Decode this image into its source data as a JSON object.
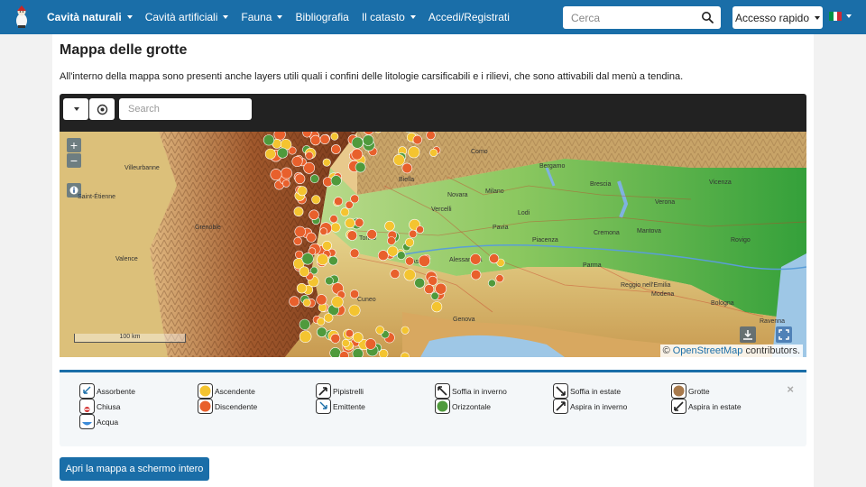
{
  "navbar": {
    "items": [
      {
        "label": "Cavità naturali",
        "dropdown": true,
        "active": true
      },
      {
        "label": "Cavità artificiali",
        "dropdown": true,
        "active": false
      },
      {
        "label": "Fauna",
        "dropdown": true,
        "active": false
      },
      {
        "label": "Bibliografia",
        "dropdown": false,
        "active": false
      },
      {
        "label": "Il catasto",
        "dropdown": true,
        "active": false
      },
      {
        "label": "Accedi/Registrati",
        "dropdown": false,
        "active": false
      }
    ],
    "search_placeholder": "Cerca",
    "search_icon": "search-icon",
    "quick_access_label": "Accesso rapido",
    "language_flag_colors": [
      "#009246",
      "#ffffff",
      "#ce2b37"
    ],
    "brand_color": "#1a6ea8"
  },
  "page": {
    "title": "Mappa delle grotte",
    "intro": "All'interno della mappa sono presenti anche layers utili quali i confini delle litologie carsificabili e i rilievi, che sono attivabili dal menù a tendina."
  },
  "map_toolbar": {
    "layers_icon": "caret-down-icon",
    "locate_icon": "target-icon",
    "search_placeholder": "Search"
  },
  "map": {
    "zoom_in": "+",
    "zoom_out": "−",
    "scale_label": "100 km",
    "attribution_prefix": "©",
    "attribution_link": "OpenStreetMap",
    "attribution_suffix": "contributors.",
    "place_labels": [
      "Como",
      "Bergamo",
      "Brescia",
      "Novara",
      "Milano",
      "Vercelli",
      "Biella",
      "Torino",
      "Asti",
      "Alessandria",
      "Pavia",
      "Piacenza",
      "Cremona",
      "Parma",
      "Reggio nell'Emilia",
      "Modena",
      "Mantova",
      "Verona",
      "Vicenza",
      "Rovigo",
      "Ravenna",
      "Genova",
      "Cuneo",
      "Grenoble",
      "Valence",
      "Villeurbanne",
      "Saint-Étienne",
      "Lodi",
      "Bologna"
    ],
    "marker_colors": {
      "ascendente": "#f4c430",
      "discendente": "#e8602c",
      "orizzontale": "#4f9a3c"
    }
  },
  "legend": {
    "close_label": "×",
    "items": [
      {
        "label": "Assorbente",
        "icon": "assorbente-icon"
      },
      {
        "label": "Ascendente",
        "icon": "yellow-circle-icon"
      },
      {
        "label": "Pipistrelli",
        "icon": "pipistrelli-icon"
      },
      {
        "label": "Soffia in inverno",
        "icon": "soffia-inverno-icon"
      },
      {
        "label": "Soffia in estate",
        "icon": "soffia-estate-icon"
      },
      {
        "label": "Grotte",
        "icon": "brown-circle-icon"
      },
      {
        "label": "Chiusa",
        "icon": "chiusa-icon"
      },
      {
        "label": "Discendente",
        "icon": "orange-circle-icon"
      },
      {
        "label": "Emittente",
        "icon": "emittente-icon"
      },
      {
        "label": "Orizzontale",
        "icon": "green-circle-icon"
      },
      {
        "label": "Aspira in inverno",
        "icon": "aspira-inverno-icon"
      },
      {
        "label": "Aspira in estate",
        "icon": "aspira-estate-icon"
      },
      {
        "label": "Acqua",
        "icon": "acqua-icon"
      }
    ]
  },
  "fullscreen_button_label": "Apri la mappa a schermo intero"
}
